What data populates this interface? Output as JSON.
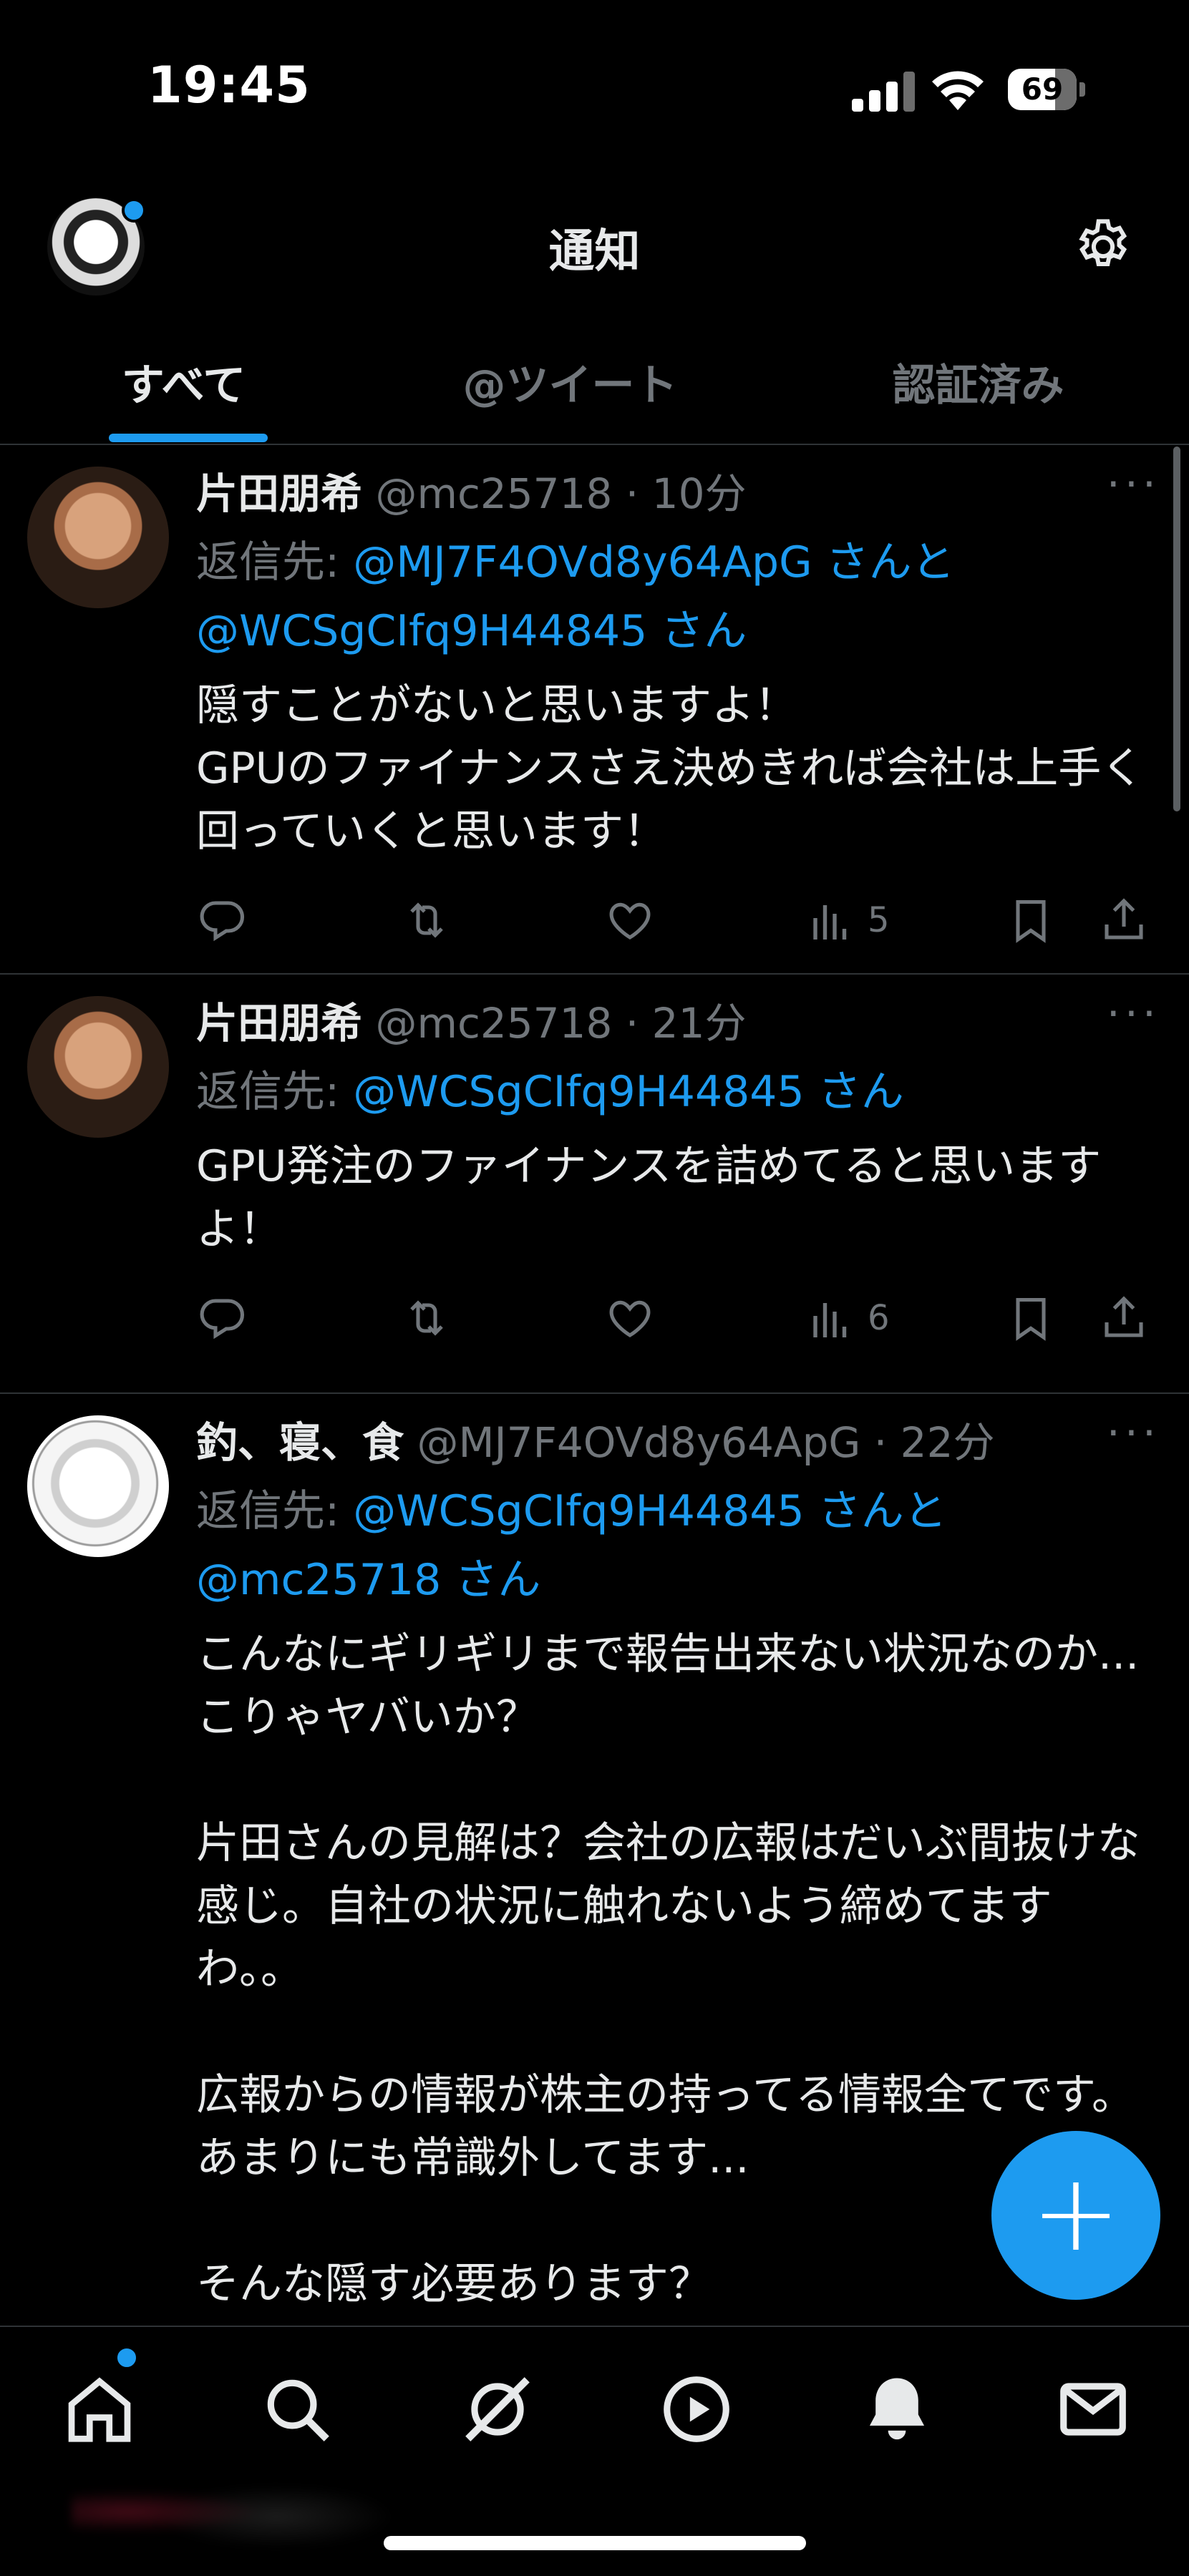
{
  "status_bar": {
    "time": "19:45",
    "battery": "69",
    "battery_level": 0.69
  },
  "header": {
    "title": "通知"
  },
  "tabs": [
    {
      "label": "すべて",
      "active": true
    },
    {
      "label": "@ツイート",
      "active": false
    },
    {
      "label": "認証済み",
      "active": false
    }
  ],
  "tweets": [
    {
      "name": "片田朋希",
      "handle": "@mc25718",
      "time": "10分",
      "reply_prefix": "返信先: ",
      "reply_mentions_1": "@MJ7F4OVd8y64ApG さんと",
      "reply_mentions_2": "@WCSgCIfq9H44845 さん",
      "text": "隠すことがないと思いますよ！\nGPUのファイナンスさえ決めきれば会社は上手く回っていくと思います！",
      "views": "5"
    },
    {
      "name": "片田朋希",
      "handle": "@mc25718",
      "time": "21分",
      "reply_prefix": "返信先: ",
      "reply_mentions_1": "@WCSgCIfq9H44845 さん",
      "text": "GPU発注のファイナンスを詰めてると思いますよ！",
      "views": "6"
    },
    {
      "name": "釣、寝、食",
      "handle": "@MJ7F4OVd8y64ApG",
      "time": "22分",
      "reply_prefix": "返信先: ",
      "reply_mentions_1": "@WCSgCIfq9H44845 さんと",
      "reply_mentions_2": "@mc25718 さん",
      "text": "こんなにギリギリまで報告出来ない状況なのか...こりゃヤバいか？\n\n片田さんの見解は？会社の広報はだいぶ間抜けな感じ。自社の状況に触れないよう締めてますわ。。\n\n広報からの情報が株主の持ってる情報全てです。あまりにも常識外してます...\n\nそんな隠す必要あります？"
    }
  ],
  "fab": {
    "label": "+"
  },
  "nav": [
    "home-icon",
    "search-icon",
    "spaces-icon",
    "video-icon",
    "notifications-icon",
    "messages-icon"
  ],
  "colors": {
    "accent": "#1d9bf0",
    "background": "#000000",
    "secondary_text": "#71767b",
    "primary_text": "#e7e9ea"
  }
}
